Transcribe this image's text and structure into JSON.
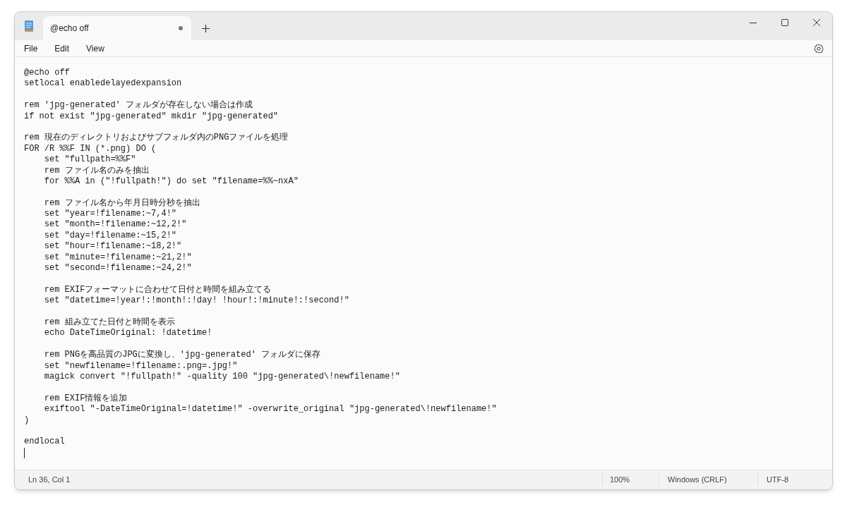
{
  "tabs": [
    {
      "label": "@echo off",
      "selected": true,
      "modified": true
    }
  ],
  "menu": [
    "File",
    "Edit",
    "View"
  ],
  "editor": {
    "code_blocks": [
      [
        "@echo off",
        "setlocal enabledelayedexpansion"
      ],
      [
        "rem 'jpg-generated' フォルダが存在しない場合は作成",
        "if not exist \"jpg-generated\" mkdir \"jpg-generated\""
      ],
      [
        "rem 現在のディレクトリおよびサブフォルダ内のPNGファイルを処理",
        "FOR /R %%F IN (*.png) DO (",
        "    set \"fullpath=%%F\"",
        "    rem ファイル名のみを抽出",
        "    for %%A in (\"!fullpath!\") do set \"filename=%%~nxA\""
      ],
      [
        "    rem ファイル名から年月日時分秒を抽出",
        "    set \"year=!filename:~7,4!\"",
        "    set \"month=!filename:~12,2!\"",
        "    set \"day=!filename:~15,2!\"",
        "    set \"hour=!filename:~18,2!\"",
        "    set \"minute=!filename:~21,2!\"",
        "    set \"second=!filename:~24,2!\""
      ],
      [
        "    rem EXIFフォーマットに合わせて日付と時間を組み立てる",
        "    set \"datetime=!year!:!month!:!day! !hour!:!minute!:!second!\""
      ],
      [
        "    rem 組み立てた日付と時間を表示",
        "    echo DateTimeOriginal: !datetime!"
      ],
      [
        "    rem PNGを高品質のJPGに変換し、'jpg-generated' フォルダに保存",
        "    set \"newfilename=!filename:.png=.jpg!\"",
        "    magick convert \"!fullpath!\" -quality 100 \"jpg-generated\\!newfilename!\""
      ],
      [
        "    rem EXIF情報を追加",
        "    exiftool \"-DateTimeOriginal=!datetime!\" -overwrite_original \"jpg-generated\\!newfilename!\"",
        ")"
      ],
      [
        "endlocal"
      ]
    ]
  },
  "status_bar": {
    "position": "Ln 36, Col 1",
    "zoom": "100%",
    "line_endings": "Windows (CRLF)",
    "encoding": "UTF-8"
  }
}
